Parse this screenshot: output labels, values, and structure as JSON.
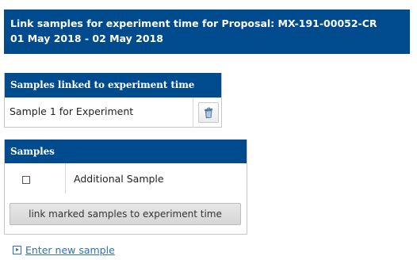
{
  "header": {
    "line1": "Link samples for experiment time for Proposal: MX-191-00052-CR",
    "line2": "01 May 2018 - 02 May 2018"
  },
  "linked_panel": {
    "title": "Samples linked to experiment time",
    "items": [
      {
        "label": "Sample 1 for Experiment",
        "action_icon": "trash-icon"
      }
    ]
  },
  "samples_panel": {
    "title": "Samples",
    "items": [
      {
        "label": "Additional Sample",
        "checked": false
      }
    ],
    "link_button_label": "link marked samples to experiment time"
  },
  "enter_new_sample": {
    "label": "Enter new sample",
    "icon": "expand-arrow-icon"
  },
  "colors": {
    "header_bg": "#004b8d",
    "link": "#2f6fb6"
  }
}
